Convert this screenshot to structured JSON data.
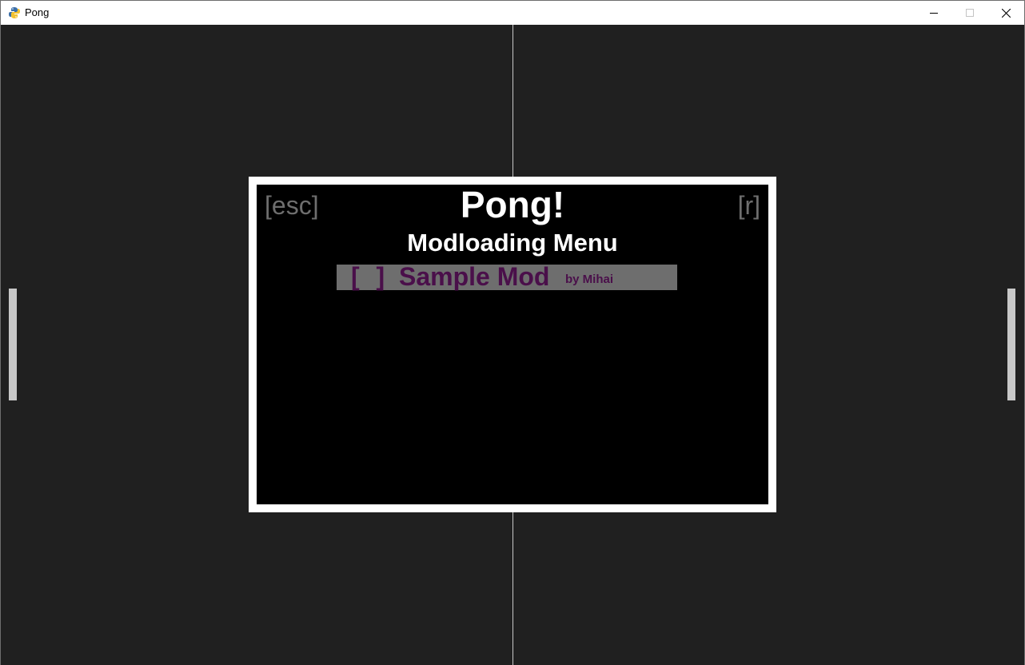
{
  "window": {
    "title": "Pong",
    "icon": "python-snake-icon"
  },
  "menu": {
    "esc_label": "[esc]",
    "reload_label": "[r]",
    "title": "Pong!",
    "subtitle": "Modloading Menu",
    "mods": [
      {
        "checkbox": "[ ]",
        "name": "Sample Mod",
        "author": "by Mihai",
        "highlighted": true
      }
    ]
  },
  "colors": {
    "background": "#202020",
    "paddle": "#c8c8c8",
    "menu_border": "#ffffff",
    "menu_bg": "#000000",
    "hint_text": "#6e6e6e",
    "selected_row": "#6e6e6e",
    "mod_text": "#4a0f4a"
  }
}
